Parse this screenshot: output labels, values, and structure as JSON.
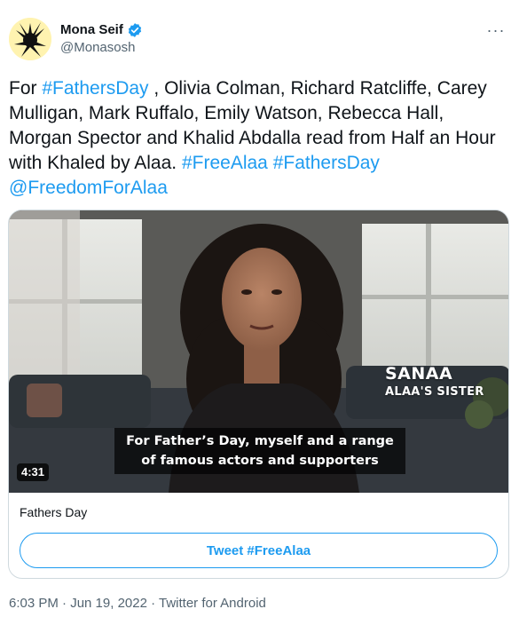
{
  "author": {
    "display_name": "Mona Seif",
    "handle": "@Monasosh",
    "verified": true
  },
  "more_button": "···",
  "tweet": {
    "segments": [
      {
        "text": "For ",
        "type": "text"
      },
      {
        "text": "#FathersDay",
        "type": "link"
      },
      {
        "text": " , Olivia Colman, Richard Ratcliffe, Carey Mulligan, Mark Ruffalo, Emily Watson, Rebecca Hall, Morgan Spector and Khalid Abdalla read from Half an Hour with Khaled by Alaa. ",
        "type": "text"
      },
      {
        "text": "#FreeAlaa",
        "type": "link"
      },
      {
        "text": " ",
        "type": "text"
      },
      {
        "text": "#FathersDay",
        "type": "link"
      },
      {
        "text": " ",
        "type": "text"
      },
      {
        "text": "@FreedomForAlaa",
        "type": "link"
      }
    ]
  },
  "video": {
    "lower_third_name": "SANAA",
    "lower_third_role": "ALAA'S SISTER",
    "subtitle": "For Father’s Day, myself and a range of famous actors and supporters",
    "duration": "4:31"
  },
  "card": {
    "title": "Fathers Day",
    "button_label": "Tweet #FreeAlaa"
  },
  "meta": {
    "timestamp": "6:03 PM · Jun 19, 2022 · Twitter for Android"
  },
  "colors": {
    "link": "#1d9bf0",
    "text": "#0f1419",
    "secondary": "#536471",
    "border": "#cfd9de"
  }
}
